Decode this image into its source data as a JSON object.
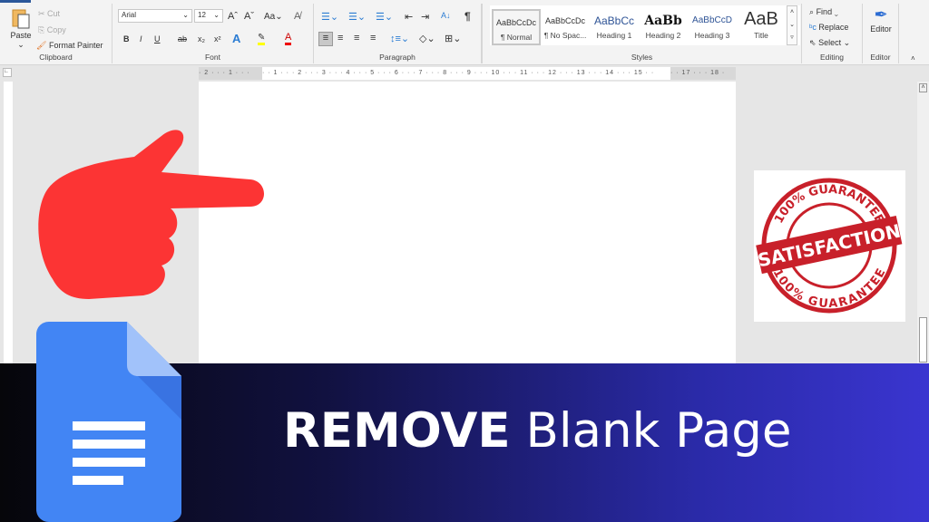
{
  "ribbon": {
    "clipboard": {
      "paste": "Paste",
      "cut": "Cut",
      "copy": "Copy",
      "format_painter": "Format Painter",
      "label": "Clipboard"
    },
    "font": {
      "name": "Arial",
      "size": "12",
      "grow": "Aˆ",
      "shrink": "Aˇ",
      "case": "Aa",
      "bold": "B",
      "italic": "I",
      "underline": "U",
      "strike": "ab",
      "sub": "x₂",
      "sup": "x²",
      "label": "Font"
    },
    "paragraph": {
      "label": "Paragraph",
      "pilcrow": "¶",
      "sort": "A↓"
    },
    "styles": {
      "label": "Styles",
      "items": [
        {
          "preview": "AaBbCcDc",
          "name": "¶ Normal"
        },
        {
          "preview": "AaBbCcDc",
          "name": "¶ No Spac..."
        },
        {
          "preview": "AaBbCc",
          "name": "Heading 1"
        },
        {
          "preview": "AaBb",
          "name": "Heading 2"
        },
        {
          "preview": "AaBbCcD",
          "name": "Heading 3"
        },
        {
          "preview": "AaB",
          "name": "Title"
        }
      ]
    },
    "editing": {
      "find": "Find",
      "replace": "Replace",
      "select": "Select",
      "label": "Editing"
    },
    "editor": {
      "button": "Editor",
      "label": "Editor"
    }
  },
  "ruler": {
    "left": "· 2 · · · 1 · · ·",
    "main": "· · 1 · · · 2 · · · 3 · · · 4 · · · 5 · · · 6 · · · 7 · · · 8 · · · 9 · · · 10 · · · 11 · · · 12 · · · 13 · · · 14 · · · 15 · ·",
    "right": "· · 17 · · · 18 ·"
  },
  "stamp": {
    "top": "100% GUARANTEE",
    "middle": "SATISFACTION",
    "bottom": "100% GUARANTEE"
  },
  "banner": {
    "bold": "REMOVE",
    "rest": " Blank Page"
  },
  "colors": {
    "hand": "#fc3434",
    "stamp": "#c8202a",
    "docs_blue": "#4285f4",
    "word_blue": "#2b579a"
  }
}
